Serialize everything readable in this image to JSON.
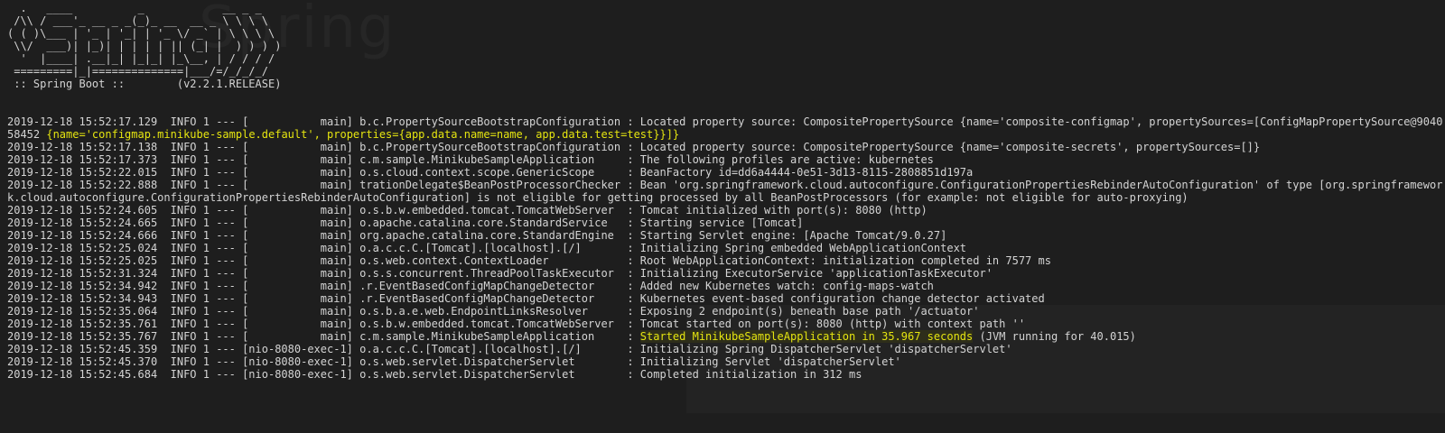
{
  "banner": [
    "  .   ____          _            __ _ _",
    " /\\\\ / ___'_ __ _ _(_)_ __  __ _ \\ \\ \\ \\",
    "( ( )\\___ | '_ | '_| | '_ \\/ _` | \\ \\ \\ \\",
    " \\\\/  ___)| |_)| | | | | || (_| |  ) ) ) )",
    "  '  |____| .__|_| |_|_| |_\\__, | / / / /",
    " =========|_|==============|___/=/_/_/_/",
    " :: Spring Boot ::        (v2.2.1.RELEASE)"
  ],
  "log": [
    {
      "text": "2019-12-18 15:52:17.129  INFO 1 --- [           main] b.c.PropertySourceBootstrapConfiguration : Located property source: CompositePropertySource {name='composite-configmap', propertySources=[ConfigMapPropertySource@904058452 ",
      "highlight": "{name='configmap.minikube-sample.default', properties={app.data.name=name, app.data.test=test}}]}",
      "after": ""
    },
    {
      "text": "2019-12-18 15:52:17.138  INFO 1 --- [           main] b.c.PropertySourceBootstrapConfiguration : Located property source: CompositePropertySource {name='composite-secrets', propertySources=[]}"
    },
    {
      "text": "2019-12-18 15:52:17.373  INFO 1 --- [           main] c.m.sample.MinikubeSampleApplication     : The following profiles are active: kubernetes"
    },
    {
      "text": "2019-12-18 15:52:22.015  INFO 1 --- [           main] o.s.cloud.context.scope.GenericScope     : BeanFactory id=dd6a4444-0e51-3d13-8115-2808851d197a"
    },
    {
      "text": "2019-12-18 15:52:22.888  INFO 1 --- [           main] trationDelegate$BeanPostProcessorChecker : Bean 'org.springframework.cloud.autoconfigure.ConfigurationPropertiesRebinderAutoConfiguration' of type [org.springframework.cloud.autoconfigure.ConfigurationPropertiesRebinderAutoConfiguration] is not eligible for getting processed by all BeanPostProcessors (for example: not eligible for auto-proxying)"
    },
    {
      "text": "2019-12-18 15:52:24.605  INFO 1 --- [           main] o.s.b.w.embedded.tomcat.TomcatWebServer  : Tomcat initialized with port(s): 8080 (http)"
    },
    {
      "text": "2019-12-18 15:52:24.665  INFO 1 --- [           main] o.apache.catalina.core.StandardService   : Starting service [Tomcat]"
    },
    {
      "text": "2019-12-18 15:52:24.666  INFO 1 --- [           main] org.apache.catalina.core.StandardEngine  : Starting Servlet engine: [Apache Tomcat/9.0.27]"
    },
    {
      "text": "2019-12-18 15:52:25.024  INFO 1 --- [           main] o.a.c.c.C.[Tomcat].[localhost].[/]       : Initializing Spring embedded WebApplicationContext"
    },
    {
      "text": "2019-12-18 15:52:25.025  INFO 1 --- [           main] o.s.web.context.ContextLoader            : Root WebApplicationContext: initialization completed in 7577 ms"
    },
    {
      "text": "2019-12-18 15:52:31.324  INFO 1 --- [           main] o.s.s.concurrent.ThreadPoolTaskExecutor  : Initializing ExecutorService 'applicationTaskExecutor'"
    },
    {
      "text": "2019-12-18 15:52:34.942  INFO 1 --- [           main] .r.EventBasedConfigMapChangeDetector     : Added new Kubernetes watch: config-maps-watch"
    },
    {
      "text": "2019-12-18 15:52:34.943  INFO 1 --- [           main] .r.EventBasedConfigMapChangeDetector     : Kubernetes event-based configuration change detector activated"
    },
    {
      "text": "2019-12-18 15:52:35.064  INFO 1 --- [           main] o.s.b.a.e.web.EndpointLinksResolver      : Exposing 2 endpoint(s) beneath base path '/actuator'"
    },
    {
      "text": "2019-12-18 15:52:35.761  INFO 1 --- [           main] o.s.b.w.embedded.tomcat.TomcatWebServer  : Tomcat started on port(s): 8080 (http) with context path ''"
    },
    {
      "text": "2019-12-18 15:52:35.767  INFO 1 --- [           main] c.m.sample.MinikubeSampleApplication     : ",
      "highlight_bg": "Started MinikubeSampleApplication in 35.967 seconds",
      "after": " (JVM running for 40.015)"
    },
    {
      "text": "2019-12-18 15:52:45.359  INFO 1 --- [nio-8080-exec-1] o.a.c.c.C.[Tomcat].[localhost].[/]       : Initializing Spring DispatcherServlet 'dispatcherServlet'"
    },
    {
      "text": "2019-12-18 15:52:45.370  INFO 1 --- [nio-8080-exec-1] o.s.web.servlet.DispatcherServlet        : Initializing Servlet 'dispatcherServlet'"
    },
    {
      "text": "2019-12-18 15:52:45.684  INFO 1 --- [nio-8080-exec-1] o.s.web.servlet.DispatcherServlet        : Completed initialization in 312 ms"
    }
  ],
  "colors": {
    "background": "#1e1e1e",
    "text": "#d4d4d4",
    "highlight": "#e5e510"
  }
}
